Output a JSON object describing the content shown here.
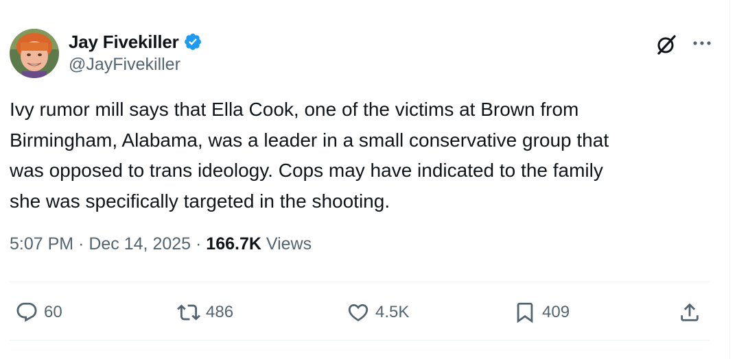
{
  "author": {
    "display_name": "Jay Fivekiller",
    "handle": "@JayFivekiller"
  },
  "tweet": {
    "text_lines": [
      "Ivy rumor mill says that Ella Cook, one of the victims at Brown from",
      "Birmingham, Alabama, was a leader in a small conservative group that",
      "was opposed to trans ideology. Cops may have indicated to the family",
      "she was specifically targeted in the shooting."
    ],
    "time": "5:07 PM",
    "separator": "·",
    "date": "Dec 14, 2025",
    "views_count": "166.7K",
    "views_label": "Views"
  },
  "actions": {
    "replies": "60",
    "reposts": "486",
    "likes": "4.5K",
    "bookmarks": "409"
  },
  "colors": {
    "text": "#0f1419",
    "secondary": "#536471",
    "verified": "#1d9bf0",
    "divider": "#eff3f4"
  },
  "icons": {
    "verified": "verified-badge-icon",
    "grok": "grok-icon",
    "more": "more-icon",
    "reply": "reply-icon",
    "repost": "repost-icon",
    "like": "like-icon",
    "bookmark": "bookmark-icon",
    "share": "share-icon"
  }
}
